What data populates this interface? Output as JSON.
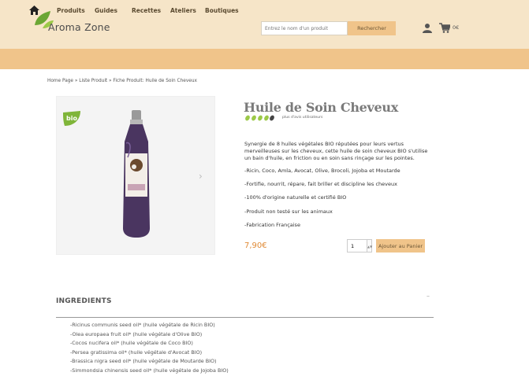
{
  "header": {
    "logo_text": "Aroma Zone",
    "search_placeholder": "Entrez le nom d'un produit",
    "search_button": "Rechercher",
    "cart_total": "0€"
  },
  "nav": {
    "items": [
      "Produits",
      "Guides",
      "Recettes",
      "Ateliers",
      "Boutiques"
    ]
  },
  "breadcrumb": "Home Page » Liste Produit » Fiche Produit: Huile de Soin Cheveux",
  "product": {
    "badge": "bio",
    "title": "Huile de Soin Cheveux",
    "rating": 4.5,
    "rating_text": "plus d'avis utilisateurs",
    "description": "Synergie de 8 huiles végétales BIO réputées pour leurs vertus merveilleuses sur les cheveux, cette huile de soin cheveux BIO s'utilise un bain d'huile, en friction ou en soin sans rinçage sur les pointes.",
    "bullets": [
      "-Ricin, Coco, Amla, Avocat, Olive, Brocoli, Jojoba et Moutarde",
      "-Fortifie, nourrit, répare, fait briller et discipline les cheveux",
      "-100% d'origine naturelle et certifié BIO",
      "-Produit non testé sur les animaux",
      "-Fabrication Française"
    ],
    "price": "7,90€",
    "quantity": "1",
    "add_to_cart": "Ajouter au Panier"
  },
  "ingredients": {
    "title": "INGREDIENTS",
    "toggle": "–",
    "items": [
      "-Ricinus communis seed oil* (huile végétale de Ricin BIO)",
      "-Olea europaea fruit oil* (huile végétale d'Olive BIO)",
      "-Cocos nucifera oil* (huile végétale de Coco BIO)",
      "-Persea gratissima oil* (huile végétale d'Avocat BIO)",
      "-Brassica nigra seed oil* (huile végétale de Moutarde BIO)",
      "-Simmondsia chinensis seed oil* (huile végétale de Jojoba BIO)"
    ]
  },
  "colors": {
    "topbar": "#f6e5c8",
    "navbar": "#f0c48a",
    "price": "#e08a35",
    "leaf_green": "#7fb539"
  }
}
